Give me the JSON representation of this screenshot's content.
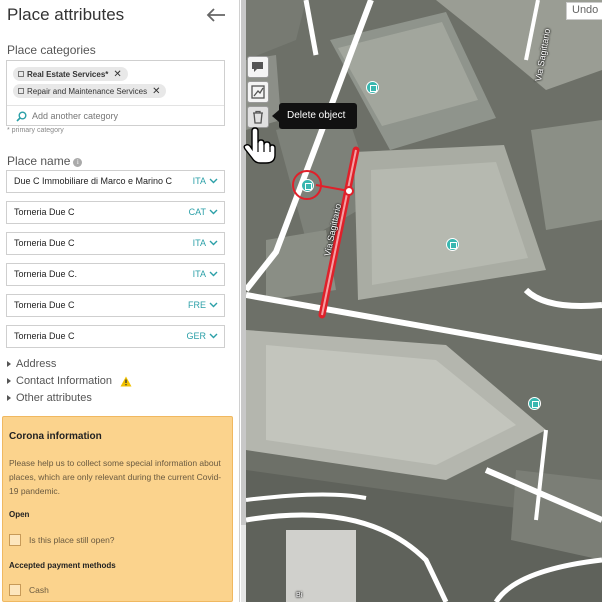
{
  "header": {
    "title": "Place attributes",
    "back_icon": "arrow-left-icon"
  },
  "categories": {
    "label": "Place categories",
    "chips": [
      {
        "label": "Real Estate Services*",
        "primary": true
      },
      {
        "label": "Repair and Maintenance Services",
        "primary": false
      }
    ],
    "add_placeholder": "Add another category",
    "hint": "* primary category"
  },
  "place_name": {
    "label": "Place name",
    "fields": [
      {
        "value": "Due C Immobiliare di Marco e Marino C",
        "lang": "ITA"
      },
      {
        "value": "Torneria Due C",
        "lang": "CAT"
      },
      {
        "value": "Torneria Due C",
        "lang": "ITA"
      },
      {
        "value": "Torneria Due C.",
        "lang": "ITA"
      },
      {
        "value": "Torneria Due C",
        "lang": "FRE"
      },
      {
        "value": "Torneria Due C",
        "lang": "GER"
      }
    ]
  },
  "sections": [
    {
      "label": "Address",
      "warning": false
    },
    {
      "label": "Contact Information",
      "warning": true
    },
    {
      "label": "Other attributes",
      "warning": false
    }
  ],
  "corona": {
    "title": "Corona information",
    "text": "Please help us to collect some special information about places, which are only relevant during the current Covid-19 pandemic.",
    "open_label": "Open",
    "open_question": "Is this place still open?",
    "payment_label": "Accepted payment methods",
    "payment_cash": "Cash"
  },
  "map": {
    "undo_label": "Undo",
    "tooltip": "Delete object",
    "street_1": "Via Sagittario",
    "street_2": "Via Sagittario",
    "footer_text": "Bi",
    "highlight_color": "#e0202a",
    "poi_color": "#39b7b0"
  },
  "toolbar": {
    "tools": [
      {
        "name": "comment-icon"
      },
      {
        "name": "edit-geometry-icon"
      },
      {
        "name": "trash-icon"
      }
    ]
  },
  "colors": {
    "accent": "#2ca0a8",
    "corona_bg": "#fbd38d",
    "warning": "#f2c200"
  }
}
